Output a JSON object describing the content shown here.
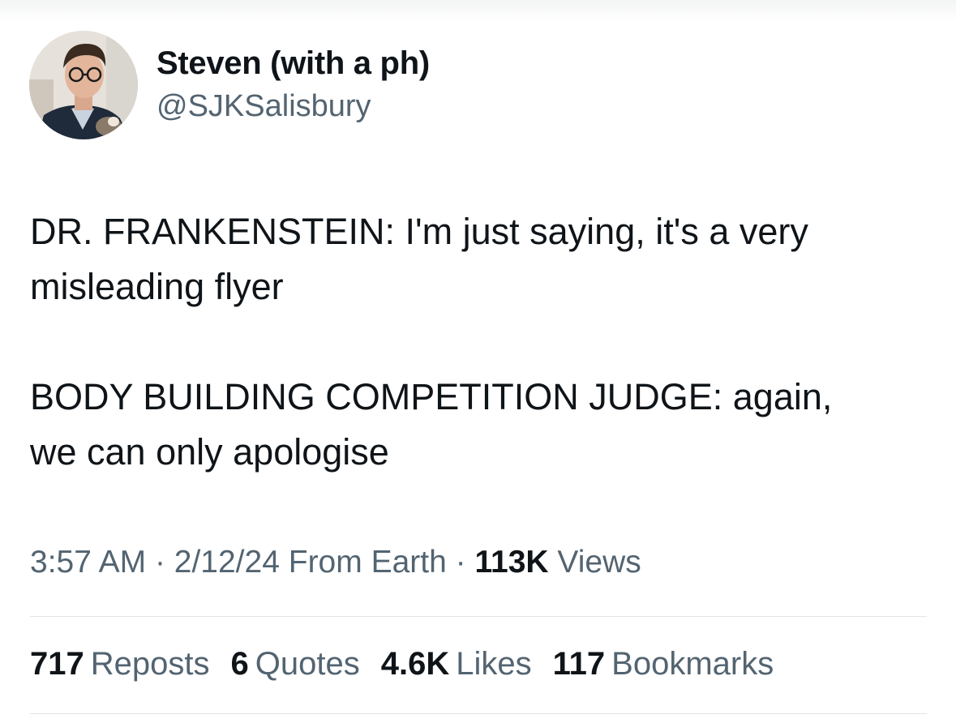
{
  "author": {
    "display_name": "Steven (with a ph)",
    "handle": "@SJKSalisbury"
  },
  "tweet": {
    "paragraphs": [
      "DR. FRANKENSTEIN: I'm just saying, it's a very\nmisleading flyer",
      "BODY BUILDING COMPETITION JUDGE: again,\nwe can only apologise"
    ]
  },
  "meta": {
    "time": "3:57 AM",
    "separator": "·",
    "date": "2/12/24",
    "source": "From Earth",
    "views_count": "113K",
    "views_label": "Views"
  },
  "stats": {
    "reposts": {
      "count": "717",
      "label": "Reposts"
    },
    "quotes": {
      "count": "6",
      "label": "Quotes"
    },
    "likes": {
      "count": "4.6K",
      "label": "Likes"
    },
    "bookmarks": {
      "count": "117",
      "label": "Bookmarks"
    }
  },
  "colors": {
    "text": "#0f1419",
    "secondary": "#536471",
    "divider": "#e1e5e8"
  }
}
